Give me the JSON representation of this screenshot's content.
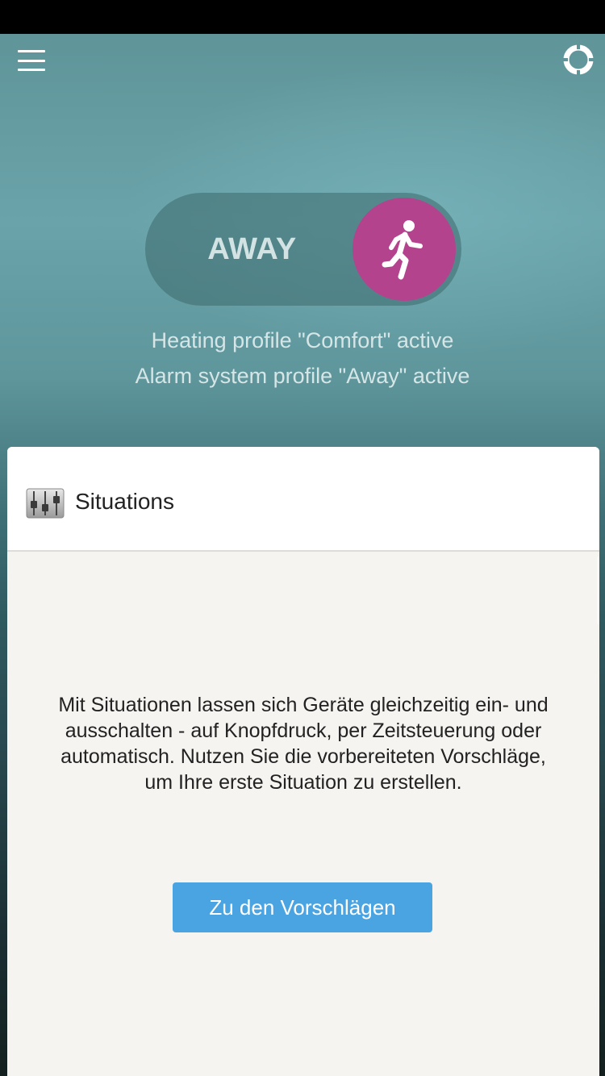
{
  "header": {
    "menu_icon": "hamburger-menu-icon",
    "settings_icon": "ring-settings-icon"
  },
  "profile_switch": {
    "label": "AWAY",
    "icon": "walking-person-icon",
    "accent_color": "#b4438d"
  },
  "status": {
    "heating": "Heating profile \"Comfort\" active",
    "alarm": "Alarm system profile \"Away\" active"
  },
  "situations_card": {
    "icon": "sliders-icon",
    "title": "Situations",
    "description": "Mit Situationen lassen sich Geräte gleichzeitig ein- und ausschalten - auf Knopfdruck, per Zeitsteuerung oder automatisch. Nutzen Sie die vorbereiteten Vorschläge, um Ihre erste Situation zu erstellen.",
    "button_label": "Zu den Vorschlägen",
    "button_color": "#4ba4e2"
  }
}
